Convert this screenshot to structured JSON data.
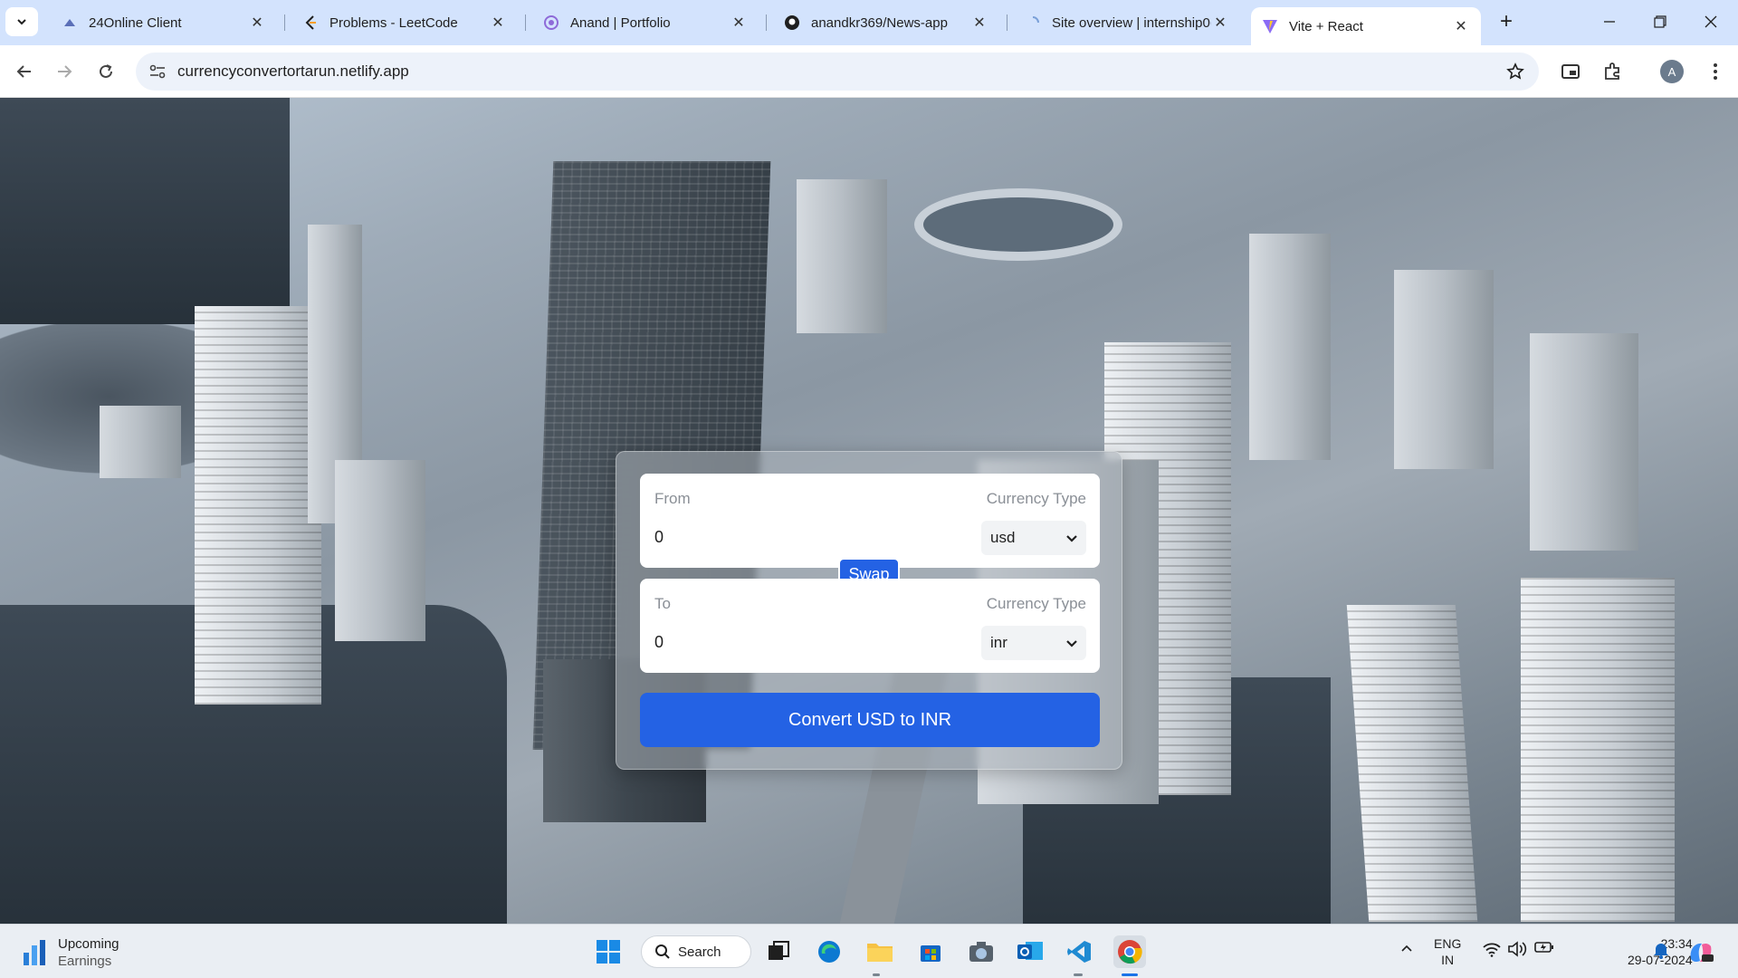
{
  "browser": {
    "tabs": [
      {
        "title": "24Online Client",
        "icon": "cloud-icon"
      },
      {
        "title": "Problems - LeetCode",
        "icon": "leetcode-icon"
      },
      {
        "title": "Anand | Portfolio",
        "icon": "portfolio-icon"
      },
      {
        "title": "anandkr369/News-app",
        "icon": "github-icon"
      },
      {
        "title": "Site overview | internship0(",
        "icon": "loading-icon"
      },
      {
        "title": "Vite + React",
        "icon": "vite-icon",
        "active": true
      }
    ],
    "url": "currencyconvertortarun.netlify.app",
    "profile_initial": "A"
  },
  "converter": {
    "from": {
      "label": "From",
      "type_label": "Currency Type",
      "value": "0",
      "currency": "usd"
    },
    "to": {
      "label": "To",
      "type_label": "Currency Type",
      "value": "0",
      "currency": "inr"
    },
    "swap_label": "Swap",
    "convert_label": "Convert USD to INR",
    "colors": {
      "primary": "#2462e4"
    }
  },
  "taskbar": {
    "weather_title": "Upcoming",
    "weather_sub": "Earnings",
    "search_label": "Search",
    "lang_top": "ENG",
    "lang_bottom": "IN",
    "time": "23:34",
    "date": "29-07-2024",
    "apps": [
      "windows-start-icon",
      "search-icon",
      "task-view-icon",
      "edge-icon",
      "file-explorer-icon",
      "store-icon",
      "camera-icon",
      "outlook-icon",
      "vscode-icon",
      "chrome-icon"
    ]
  }
}
